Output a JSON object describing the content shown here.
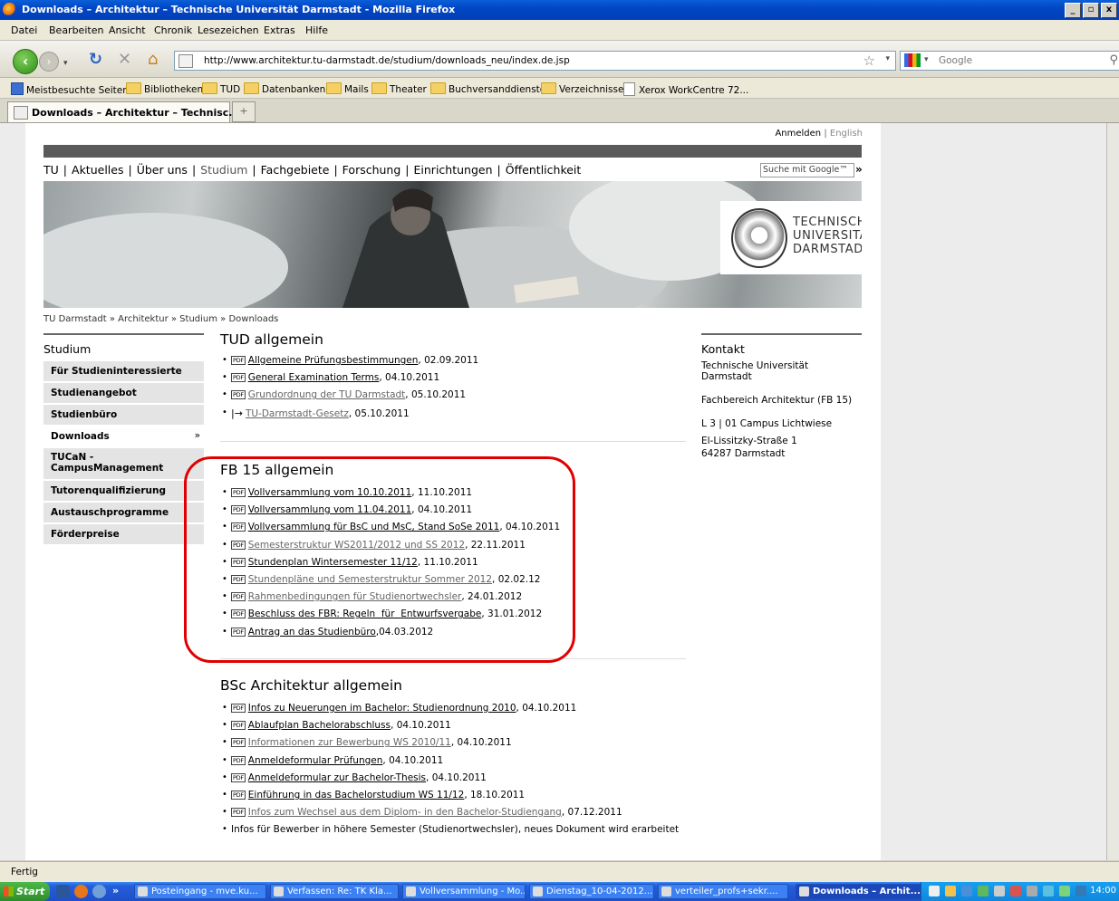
{
  "window": {
    "title": "Downloads – Architektur – Technische Universität Darmstadt - Mozilla Firefox",
    "min": "_",
    "max": "▫",
    "close": "x"
  },
  "menu": [
    "Datei",
    "Bearbeiten",
    "Ansicht",
    "Chronik",
    "Lesezeichen",
    "Extras",
    "Hilfe"
  ],
  "nav": {
    "url": "http://www.architektur.tu-darmstadt.de/studium/downloads_neu/index.de.jsp",
    "search_placeholder": "Google"
  },
  "bookmarks": [
    "Meistbesuchte Seiten",
    "Bibliotheken",
    "TUD",
    "Datenbanken",
    "Mails",
    "Theater",
    "Buchversanddienste",
    "Verzeichnisse",
    "Xerox WorkCentre 72..."
  ],
  "tabs": [
    {
      "label": "Downloads – Architektur – Technisc..."
    }
  ],
  "newtab": "+",
  "page": {
    "toplinks": {
      "login": "Anmelden",
      "sep": "|",
      "english": "English"
    },
    "topnav": [
      "TU",
      "Aktuelles",
      "Über uns",
      "Studium",
      "Fachgebiete",
      "Forschung",
      "Einrichtungen",
      "Öffentlichkeit"
    ],
    "topnav_sep": "|",
    "search_placeholder": "Suche mit Google™",
    "search_go": "»",
    "logo": {
      "line1": "TECHNISCHE",
      "line2": "UNIVERSITÄT",
      "line3": "DARMSTADT"
    },
    "breadcrumb": "TU Darmstadt » Architektur » Studium » Downloads",
    "leftnav": {
      "heading": "Studium",
      "items": [
        {
          "label": "Für Studieninteressierte"
        },
        {
          "label": "Studienangebot"
        },
        {
          "label": "Studienbüro"
        },
        {
          "label": "Downloads",
          "arrow": "»"
        },
        {
          "label": "TUCaN - CampusManagement"
        },
        {
          "label": "Tutorenqualifizierung"
        },
        {
          "label": "Austauschprogramme"
        },
        {
          "label": "Förderpreise"
        }
      ]
    },
    "pdf_label": "PDF",
    "arrow_icon": "|→",
    "sections": [
      {
        "title": "TUD allgemein",
        "items": [
          {
            "link": "Allgemeine Prüfungsbestimmungen",
            "date": ", 02.09.2011"
          },
          {
            "link": "General Examination Terms",
            "date": ", 04.10.2011"
          },
          {
            "link": "Grundordnung der TU Darmstadt",
            "date": ", 05.10.2011"
          },
          {
            "link": "TU-Darmstadt-Gesetz",
            "date": ", 05.10.2011"
          }
        ]
      },
      {
        "title": "FB 15 allgemein",
        "items": [
          {
            "link": "Vollversammlung vom 10.10.2011",
            "date": ", 11.10.2011"
          },
          {
            "link": "Vollversammlung vom 11.04.2011",
            "date": ", 04.10.2011"
          },
          {
            "link": "Vollversammlung für BsC und MsC, Stand SoSe 2011",
            "date": ", 04.10.2011"
          },
          {
            "link": "Semesterstruktur WS2011/2012 und SS 2012",
            "date": ", 22.11.2011"
          },
          {
            "link": "Stundenplan Wintersemester 11/12",
            "date": ", 11.10.2011"
          },
          {
            "link": "Stundenpläne und Semesterstruktur Sommer 2012",
            "date": ", 02.02.12"
          },
          {
            "link": "Rahmenbedingungen für Studienortwechsler",
            "date": ", 24.01.2012"
          },
          {
            "link": "Beschluss des FBR: Regeln  für  Entwurfsvergabe",
            "date": ", 31.01.2012"
          },
          {
            "link": "Antrag an das Studienbüro",
            "date": ",04.03.2012"
          }
        ]
      },
      {
        "title": "BSc Architektur allgemein",
        "items": [
          {
            "link": "Infos zu Neuerungen im Bachelor: Studienordnung 2010",
            "date": ", 04.10.2011"
          },
          {
            "link": "Ablaufplan Bachelorabschluss",
            "date": ", 04.10.2011"
          },
          {
            "link": "Informationen zur Bewerbung WS 2010/11",
            "date": ", 04.10.2011"
          },
          {
            "link": "Anmeldeformular Prüfungen",
            "date": ", 04.10.2011"
          },
          {
            "link": "Anmeldeformular zur Bachelor-Thesis",
            "date": ", 04.10.2011"
          },
          {
            "link": "Einführung in das Bachelorstudium WS 11/12",
            "date": ", 18.10.2011"
          },
          {
            "link": "Infos zum Wechsel aus dem Diplom- in den Bachelor-Studiengang",
            "date": ", 07.12.2011"
          },
          {
            "text": "Infos für Bewerber in höhere Semester (Studienortwechsler), neues Dokument wird erarbeitet"
          }
        ]
      }
    ],
    "kontakt": {
      "heading": "Kontakt",
      "org": "Technische Universität Darmstadt",
      "dept": "Fachbereich Architektur (FB 15)",
      "building": "L 3 | 01 Campus Lichtwiese",
      "street": "El-Lissitzky-Straße 1",
      "city": "64287 Darmstadt"
    }
  },
  "status": "Fertig",
  "taskbar": {
    "start": "Start",
    "more": "»",
    "items": [
      "Posteingang - mve.ku...",
      "Verfassen: Re: TK Kla...",
      "Vollversammlung - Mo...",
      "Dienstag_10-04-2012...",
      "verteiler_profs+sekr....",
      "Downloads – Archit..."
    ],
    "clock": "14:00"
  }
}
